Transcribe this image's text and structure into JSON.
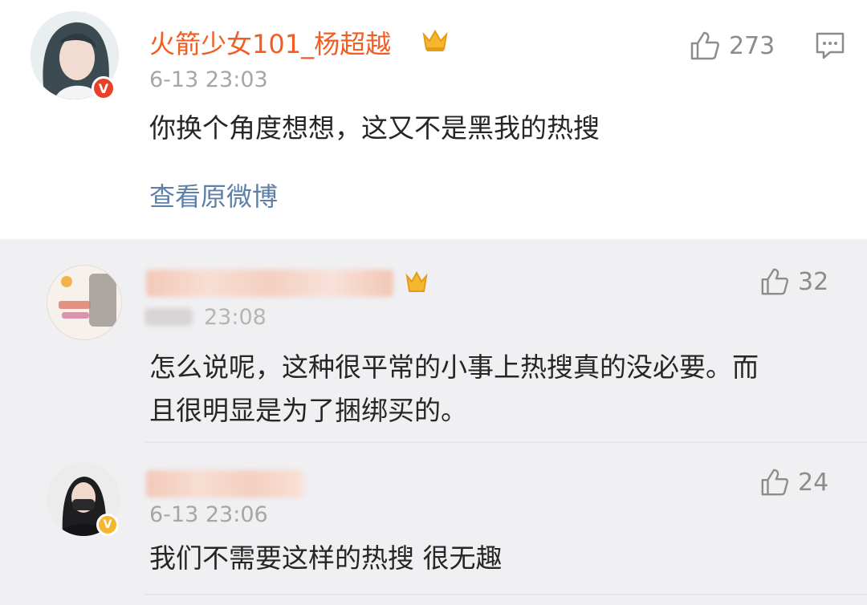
{
  "post": {
    "username": "火箭少女101_杨超越",
    "time": "6-13 23:03",
    "text": "你换个角度想想，这又不是黑我的热搜",
    "link": "查看原微博",
    "likes": "273",
    "badge": "V"
  },
  "comments": [
    {
      "time": "23:08",
      "text_line1": "怎么说呢，这种很平常的小事上热搜真的没必要。而",
      "text_line2": "且很明显是为了捆绑买的。",
      "likes": "32"
    },
    {
      "time": "6-13 23:06",
      "text": "我们不需要这样的热搜 很无趣",
      "likes": "24",
      "badge": "V"
    }
  ],
  "colors": {
    "username": "#f15d22",
    "link": "#5d7fa8",
    "badge_red": "#e8412b",
    "badge_gold": "#f5b72f"
  }
}
